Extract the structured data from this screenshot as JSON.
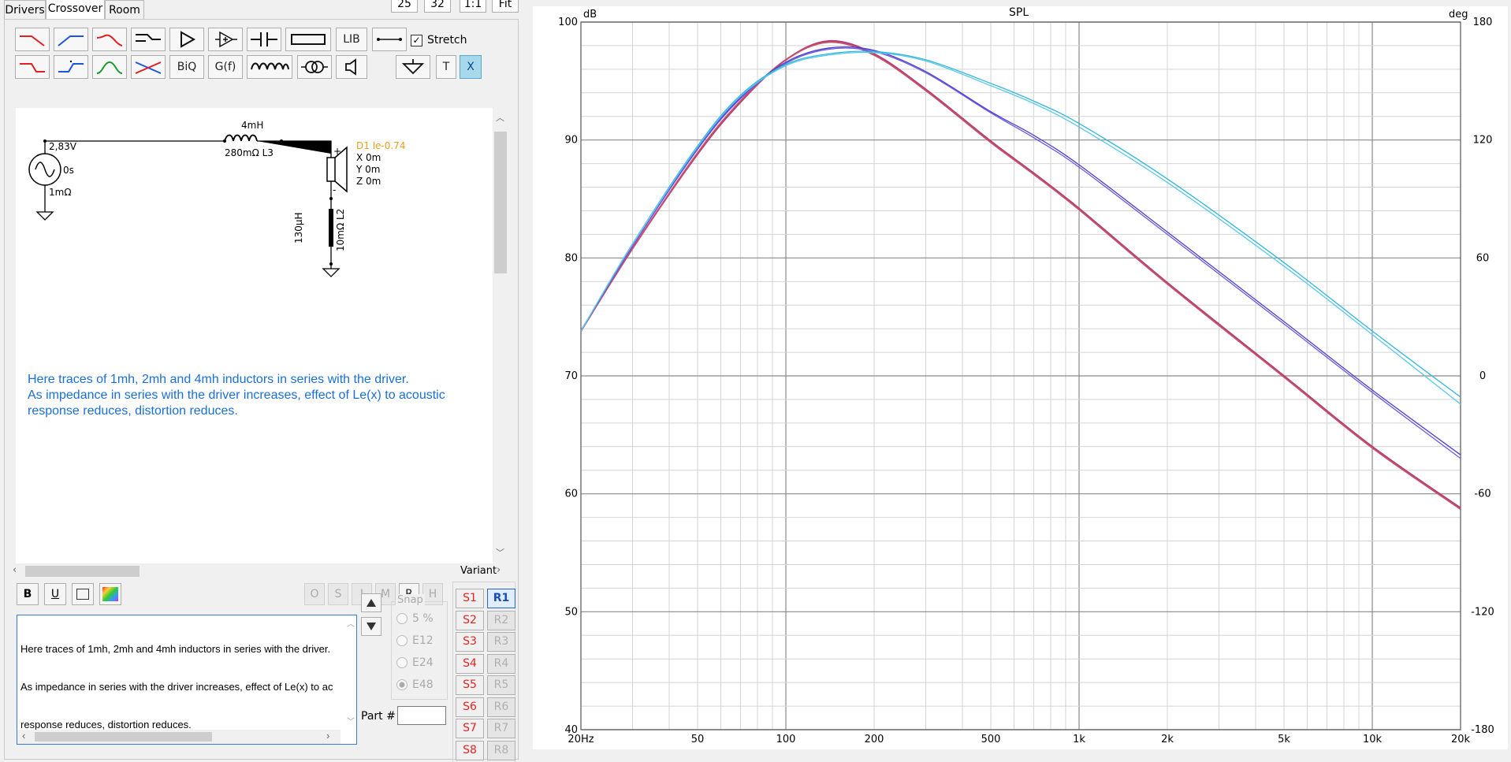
{
  "tabs": [
    "Drivers",
    "Crossover",
    "Room"
  ],
  "top_buttons": [
    "25",
    "32",
    "1:1",
    "Fit"
  ],
  "toolbar": {
    "row1_text": {
      "lib": "LIB"
    },
    "row2_text": {
      "biq": "BiQ",
      "gf": "G(f)",
      "t": "T",
      "x": "X"
    },
    "stretch_label": "Stretch",
    "stretch_checked": true
  },
  "schematic": {
    "source_voltage": "2,83V",
    "source_delay": "0s",
    "source_resistance": "1mΩ",
    "l3_value": "4mH",
    "l3_label": "280mΩ L3",
    "driver_name": "D1 le-0.74",
    "driver_x": "X 0m",
    "driver_y": "Y 0m",
    "driver_z": "Z 0m",
    "l2_value": "130µH",
    "l2_label": "10mΩ L2",
    "plus": "+",
    "minus": "-",
    "note_line1": "Here traces of 1mh, 2mh and 4mh inductors in series with the driver.",
    "note_line2": "As impedance in series with the driver increases, effect of Le(x) to acoustic",
    "note_line3": "response reduces, distortion reduces."
  },
  "format_buttons": {
    "bold": "B",
    "underline": "U"
  },
  "mode_buttons": [
    "O",
    "S",
    "I",
    "M",
    "R",
    "H"
  ],
  "text_editor": {
    "line1": "Here traces of 1mh, 2mh and 4mh inductors in series with the driver.",
    "line2": "As impedance in series with the driver increases, effect of Le(x) to ac",
    "line3": "response reduces, distortion reduces."
  },
  "snap": {
    "title": "Snap",
    "options": [
      "5 %",
      "E12",
      "E24",
      "E48"
    ],
    "selected": "E48"
  },
  "part_label": "Part #",
  "part_value": "",
  "variant": {
    "title": "Variant",
    "s": [
      "S1",
      "S2",
      "S3",
      "S4",
      "S5",
      "S6",
      "S7",
      "S8"
    ],
    "r": [
      "R1",
      "R2",
      "R3",
      "R4",
      "R5",
      "R6",
      "R7",
      "R8"
    ],
    "selected": "R1"
  },
  "chart_data": {
    "type": "line",
    "title": "SPL",
    "ylabel_left": "dB",
    "ylabel_right": "deg",
    "x_scale": "log",
    "xlim": [
      20,
      20000
    ],
    "ylim": [
      40,
      100
    ],
    "y2lim": [
      -180,
      180
    ],
    "x_tick_labels": [
      "20Hz",
      "50",
      "100",
      "200",
      "500",
      "1k",
      "2k",
      "5k",
      "10k",
      "20k"
    ],
    "x_ticks": [
      20,
      50,
      100,
      200,
      500,
      1000,
      2000,
      5000,
      10000,
      20000
    ],
    "y_ticks": [
      40,
      50,
      60,
      70,
      80,
      90,
      100
    ],
    "y2_ticks": [
      -180,
      -120,
      -60,
      0,
      60,
      120,
      180
    ],
    "grid": true,
    "x": [
      20,
      30,
      50,
      70,
      100,
      140,
      200,
      300,
      500,
      700,
      1000,
      2000,
      5000,
      10000,
      20000
    ],
    "series": [
      {
        "color": "#b03a7a",
        "values": [
          73.8,
          80.8,
          88.8,
          93.2,
          96.8,
          98.4,
          97.3,
          94.3,
          89.9,
          87.2,
          84.2,
          77.9,
          70.0,
          64.0,
          58.8
        ]
      },
      {
        "color": "#c44f6a",
        "values": [
          73.8,
          80.8,
          88.9,
          93.3,
          96.8,
          98.3,
          97.2,
          94.2,
          89.8,
          87.1,
          84.1,
          77.8,
          69.9,
          63.9,
          58.7
        ]
      },
      {
        "color": "#4a3ed0",
        "values": [
          73.8,
          81.0,
          89.3,
          93.6,
          96.6,
          97.8,
          97.6,
          95.8,
          92.4,
          90.4,
          87.9,
          82.2,
          74.6,
          68.8,
          63.3
        ]
      },
      {
        "color": "#6a5ae0",
        "values": [
          73.8,
          81.0,
          89.2,
          93.5,
          96.5,
          97.7,
          97.5,
          95.7,
          92.3,
          90.2,
          87.7,
          82.0,
          74.4,
          68.6,
          63.0
        ]
      },
      {
        "color": "#2fb6dc",
        "values": [
          73.8,
          81.2,
          89.5,
          93.8,
          96.4,
          97.3,
          97.5,
          96.8,
          94.8,
          93.3,
          91.4,
          86.7,
          79.6,
          73.8,
          68.2
        ]
      },
      {
        "color": "#5cc7ea",
        "values": [
          73.8,
          81.2,
          89.4,
          93.7,
          96.3,
          97.2,
          97.4,
          96.7,
          94.6,
          93.1,
          91.1,
          86.4,
          79.3,
          73.5,
          67.6
        ]
      }
    ]
  }
}
